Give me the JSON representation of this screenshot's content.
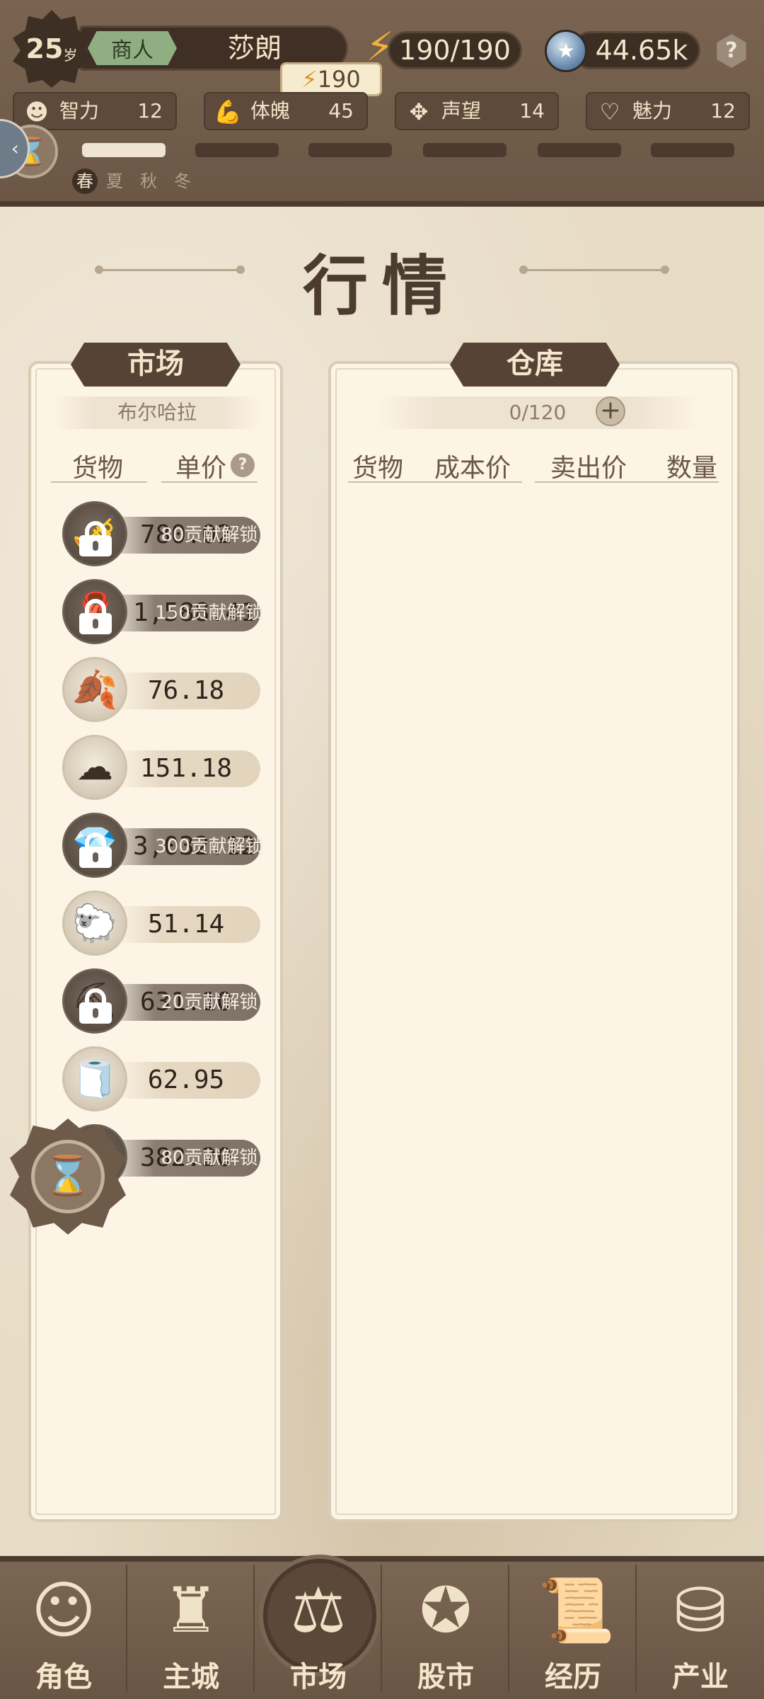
{
  "header": {
    "age": "25",
    "age_unit": "岁",
    "job": "商人",
    "name": "莎朗",
    "energy": "190/190",
    "energy_tooltip": "190",
    "coins": "44.65k",
    "help_glyph": "?",
    "stats": [
      {
        "icon": "brain-icon",
        "label": "智力",
        "value": "12"
      },
      {
        "icon": "muscle-icon",
        "label": "体魄",
        "value": "45"
      },
      {
        "icon": "reputation-icon",
        "label": "声望",
        "value": "14"
      },
      {
        "icon": "heart-icon",
        "label": "魅力",
        "value": "12"
      }
    ],
    "seasons": [
      "春",
      "夏",
      "秋",
      "冬"
    ],
    "current_season_index": 0,
    "season_progress_segments": 6,
    "season_progress_filled": 1
  },
  "page": {
    "title": "行情"
  },
  "market": {
    "header": "市场",
    "location": "布尔哈拉",
    "col_goods": "货物",
    "col_price": "单价",
    "help_glyph": "?",
    "rows": [
      {
        "icon": "horn-icon",
        "price": "780.02",
        "locked": true,
        "lock_text": "80贡献解锁"
      },
      {
        "icon": "fabric-icon",
        "price": "1,588.41",
        "locked": true,
        "lock_text": "150贡献解锁"
      },
      {
        "icon": "leaf-icon",
        "price": "76.18",
        "locked": false
      },
      {
        "icon": "cotton-icon",
        "price": "151.18",
        "locked": false
      },
      {
        "icon": "crystal-icon",
        "price": "3,032.12",
        "locked": true,
        "lock_text": "300贡献解锁"
      },
      {
        "icon": "wool-icon",
        "price": "51.14",
        "locked": false
      },
      {
        "icon": "ore-icon",
        "price": "631.10",
        "locked": true,
        "lock_text": "20贡献解锁"
      },
      {
        "icon": "cloth-icon",
        "price": "62.95",
        "locked": false
      },
      {
        "icon": "goods-icon",
        "price": "382.20",
        "locked": true,
        "lock_text": "80贡献解锁"
      }
    ]
  },
  "warehouse": {
    "header": "仓库",
    "capacity": "0/120",
    "col_goods": "货物",
    "col_cost": "成本价",
    "col_sell": "卖出价",
    "col_qty": "数量"
  },
  "nav": [
    {
      "icon": "character-icon",
      "label": "角色"
    },
    {
      "icon": "castle-icon",
      "label": "主城"
    },
    {
      "icon": "scales-icon",
      "label": "市场"
    },
    {
      "icon": "stock-icon",
      "label": "股市"
    },
    {
      "icon": "scroll-icon",
      "label": "经历"
    },
    {
      "icon": "coins-icon",
      "label": "产业"
    }
  ],
  "colors": {
    "header_bg": "#6c5645",
    "panel_bg": "#fcf4e5",
    "accent_gold": "#f0b23b",
    "job_tag": "#8fae82"
  }
}
